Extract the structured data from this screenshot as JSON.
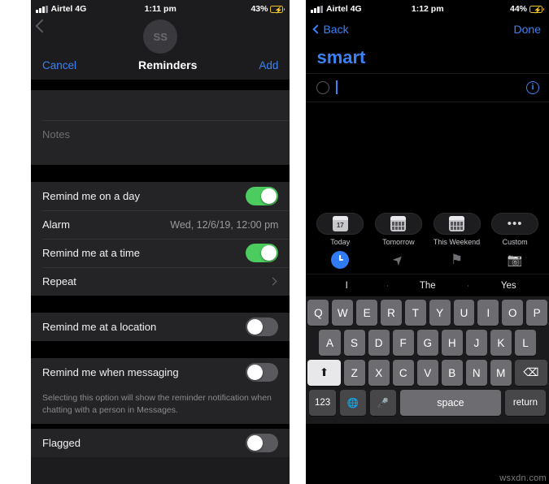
{
  "left_phone": {
    "status_bar": {
      "carrier": "Airtel 4G",
      "time": "1:11 pm",
      "battery_percent": "43%",
      "signal_icon": "signal-bars-icon",
      "battery_icon": "battery-low-power-icon"
    },
    "background": {
      "back_icon": "back-chevron-icon",
      "avatar_initials": "SS"
    },
    "navbar": {
      "cancel_label": "Cancel",
      "title": "Reminders",
      "add_label": "Add"
    },
    "fields": {
      "title_placeholder": "",
      "notes_placeholder": "Notes"
    },
    "rows": [
      {
        "label": "Remind me on a day",
        "control": "toggle",
        "state": "on"
      },
      {
        "label": "Alarm",
        "control": "value",
        "value": "Wed, 12/6/19, 12:00 pm"
      },
      {
        "label": "Remind me at a time",
        "control": "toggle",
        "state": "on"
      },
      {
        "label": "Repeat",
        "control": "chevron",
        "value": ""
      }
    ],
    "location_row": {
      "label": "Remind me at a location",
      "state": "off"
    },
    "messaging_row": {
      "label": "Remind me when messaging",
      "state": "off"
    },
    "footnote": "Selecting this option will show the reminder notification when chatting with a person in Messages.",
    "clipped_row": {
      "label": "Flagged",
      "state": "off"
    }
  },
  "right_phone": {
    "status_bar": {
      "carrier": "Airtel 4G",
      "time": "1:12 pm",
      "battery_percent": "44%",
      "signal_icon": "signal-bars-icon",
      "battery_icon": "battery-low-power-icon"
    },
    "navbar": {
      "back_label": "Back",
      "done_label": "Done"
    },
    "list_title": "smart",
    "reminder": {
      "checkbox_icon": "empty-circle-icon",
      "text": "",
      "info_icon": "info-circle-icon"
    },
    "quick_actions": [
      {
        "label": "Today",
        "icon": "calendar-17-icon",
        "day_number": "17"
      },
      {
        "label": "Tomorrow",
        "icon": "calendar-icon"
      },
      {
        "label": "This Weekend",
        "icon": "calendar-icon"
      },
      {
        "label": "Custom",
        "icon": "ellipsis-icon",
        "glyph": "•••"
      }
    ],
    "action_icons": [
      {
        "name": "clock-icon",
        "state": "active"
      },
      {
        "name": "location-arrow-icon",
        "state": "inactive",
        "glyph": "➤"
      },
      {
        "name": "flag-icon",
        "state": "inactive",
        "glyph": "⚑"
      },
      {
        "name": "camera-icon",
        "state": "inactive",
        "glyph": "📷"
      }
    ],
    "predictive": [
      "I",
      "The",
      "Yes"
    ],
    "keyboard": {
      "row1": [
        "Q",
        "W",
        "E",
        "R",
        "T",
        "Y",
        "U",
        "I",
        "O",
        "P"
      ],
      "row2": [
        "A",
        "S",
        "D",
        "F",
        "G",
        "H",
        "J",
        "K",
        "L"
      ],
      "row3": [
        "Z",
        "X",
        "C",
        "V",
        "B",
        "N",
        "M"
      ],
      "shift_glyph": "⬆",
      "backspace_glyph": "⌫",
      "numbers_label": "123",
      "globe_glyph": "🌐",
      "mic_glyph": "🎤",
      "space_label": "space",
      "return_label": "return"
    }
  },
  "watermark": "wsxdn.com",
  "colors": {
    "accent_blue": "#3c82f6",
    "toggle_on_green": "#4ccb5e",
    "battery_yellow": "#e8c22a"
  }
}
